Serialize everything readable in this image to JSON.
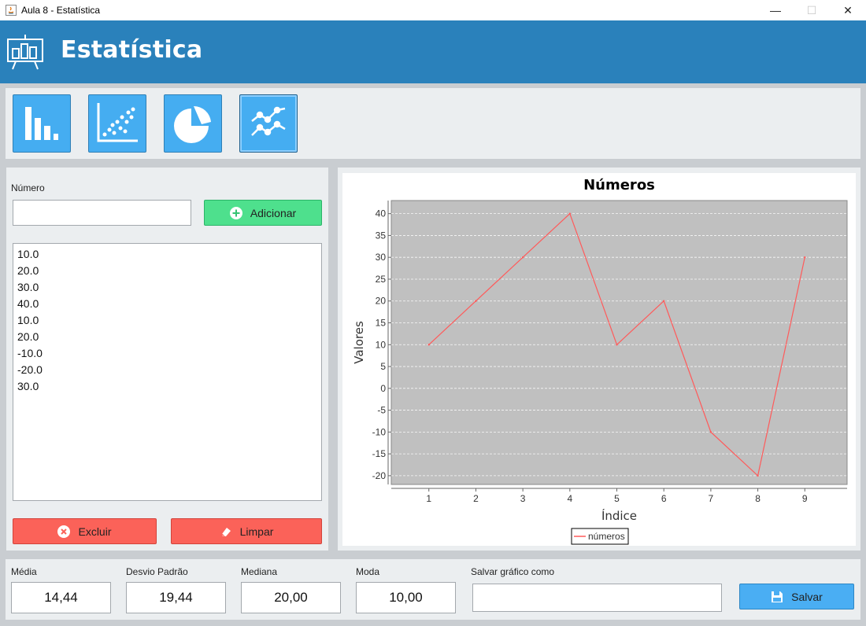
{
  "window": {
    "title": "Aula 8 - Estatística",
    "controls": {
      "minimize": "—",
      "maximize": "☐",
      "close": "✕"
    }
  },
  "header": {
    "title": "Estatística"
  },
  "toolbar": {
    "buttons": [
      {
        "icon": "bar-chart-icon"
      },
      {
        "icon": "scatter-plot-icon"
      },
      {
        "icon": "pie-chart-icon"
      },
      {
        "icon": "line-chart-icon",
        "active": true
      }
    ]
  },
  "left": {
    "numero_label": "Número",
    "numero_value": "",
    "add_label": "Adicionar",
    "list": [
      "10.0",
      "20.0",
      "30.0",
      "40.0",
      "10.0",
      "20.0",
      "-10.0",
      "-20.0",
      "30.0"
    ],
    "delete_label": "Excluir",
    "clear_label": "Limpar"
  },
  "stats": {
    "media_label": "Média",
    "media_value": "14,44",
    "desvio_label": "Desvio Padrão",
    "desvio_value": "19,44",
    "mediana_label": "Mediana",
    "mediana_value": "20,00",
    "moda_label": "Moda",
    "moda_value": "10,00",
    "salvar_label": "Salvar gráfico como",
    "salvar_value": "",
    "save_button_label": "Salvar"
  },
  "colors": {
    "header": "#2a81bb",
    "plot_bg": "#c0c0c0",
    "line": "#ff5a5a",
    "green": "#4ee08d",
    "red": "#fb6259",
    "blue": "#4aaef3"
  },
  "chart_data": {
    "type": "line",
    "title": "Números",
    "xlabel": "Índice",
    "ylabel": "Valores",
    "x": [
      1,
      2,
      3,
      4,
      5,
      6,
      7,
      8,
      9
    ],
    "series": [
      {
        "name": "números",
        "values": [
          10,
          20,
          30,
          40,
          10,
          20,
          -10,
          -20,
          30
        ]
      }
    ],
    "xlim": [
      0.2,
      9.9
    ],
    "ylim": [
      -22,
      43
    ],
    "xticks": [
      1,
      2,
      3,
      4,
      5,
      6,
      7,
      8,
      9
    ],
    "yticks": [
      -20,
      -15,
      -10,
      -5,
      0,
      5,
      10,
      15,
      20,
      25,
      30,
      35,
      40
    ],
    "grid": true,
    "legend": "bottom"
  }
}
